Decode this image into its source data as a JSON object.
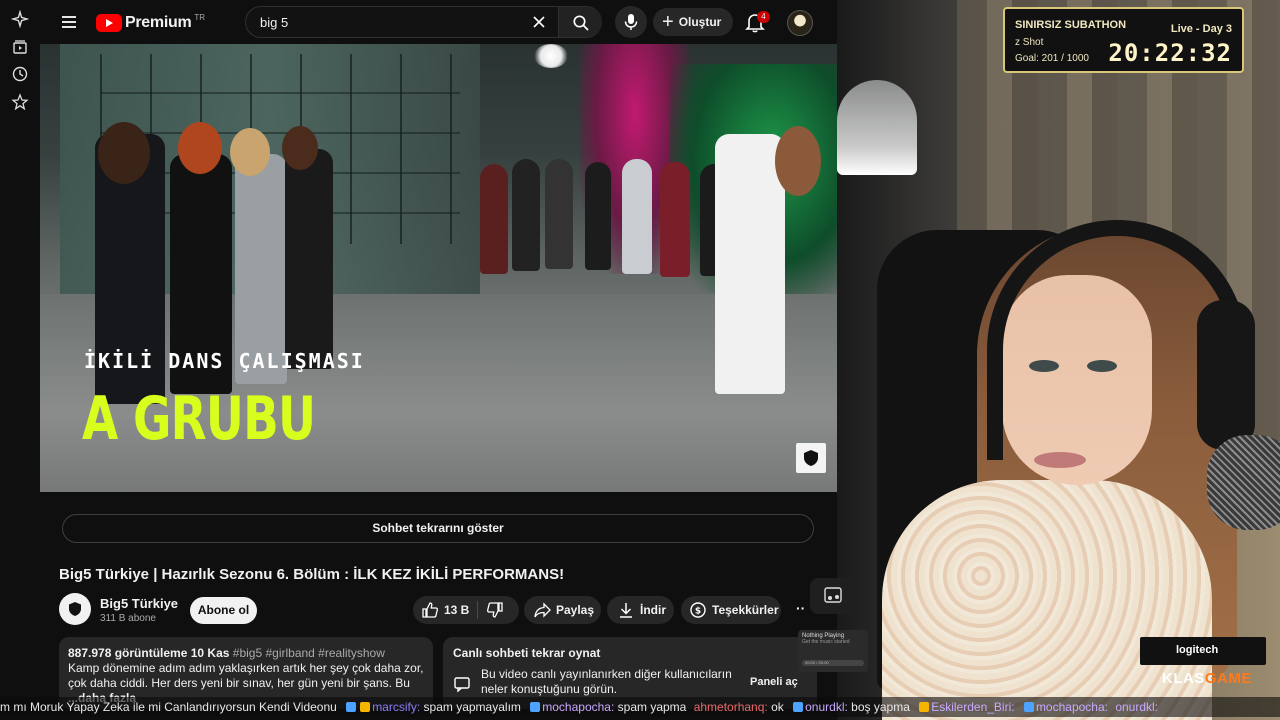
{
  "header": {
    "logo_text": "Premium",
    "logo_region": "TR",
    "search_value": "big 5",
    "create_label": "Oluştur",
    "notification_count": "4"
  },
  "rail_icons": [
    "sparkle-icon",
    "subscriptions-icon",
    "history-icon",
    "star-icon"
  ],
  "video": {
    "overlay_subtitle": "İKİLİ DANS ÇALIŞMASI",
    "overlay_title": "A GRUBU",
    "wall_sign": "bpers"
  },
  "chat_replay_label": "Sohbet tekrarını göster",
  "title": "Big5 Türkiye | Hazırlık Sezonu 6. Bölüm : İLK KEZ İKİLİ PERFORMANS!",
  "channel": {
    "name": "Big5 Türkiye",
    "subscribers": "311 B abone",
    "subscribe_label": "Abone ol"
  },
  "actions": {
    "like_count": "13 B",
    "share_label": "Paylaş",
    "download_label": "İndir",
    "thanks_label": "Teşekkürler"
  },
  "description": {
    "views": "887.978 görüntüleme",
    "date": "10 Kas",
    "tags": "#big5 #girlband #realityshow",
    "text": "Kamp dönemine adım adım yaklaşırken artık her şey çok daha zor, çok daha ciddi. Her ders yeni bir sınav, her gün yeni bir şans. Bu",
    "more": "...daha fazla"
  },
  "live_chat": {
    "title": "Canlı sohbeti tekrar oynat",
    "body": "Bu video canlı yayınlanırken diğer kullanıcıların neler konuştuğunu görün.",
    "button": "Paneli aç"
  },
  "now_playing": {
    "title": "Nothing Playing",
    "subtitle": "Get the music started",
    "time": "00:00 • 00:00"
  },
  "subathon": {
    "title": "SINIRSIZ SUBATHON",
    "live": "Live - Day 3",
    "shot": "z Shot",
    "goal": "Goal: 201 / 1000",
    "timer": "20:22:32"
  },
  "cam_brand": {
    "logi": "logitech",
    "klas_a": "KLAS",
    "klas_b": "GAME"
  },
  "ticker": [
    {
      "user": "",
      "msg": "m mı Moruk Yapay Zeka ile mi Canlandırıyorsun Kendi Videonu"
    },
    {
      "user": "marcsify:",
      "msg": "spam yapmayalım"
    },
    {
      "user": "mochapocha:",
      "msg": "spam yapma"
    },
    {
      "user": "ahmetorhanq:",
      "msg": "ok"
    },
    {
      "user": "onurdkl:",
      "msg": "boş yapma"
    },
    {
      "user": "Eskilerden_Biri:",
      "msg": ""
    },
    {
      "user": "mochapocha:",
      "msg": ""
    },
    {
      "user": "onurdkl:",
      "msg": ""
    }
  ],
  "colors": {
    "accent_red": "#ff0000",
    "overlay_title": "#d7ff1d",
    "subathon_border": "#d8c77a"
  }
}
